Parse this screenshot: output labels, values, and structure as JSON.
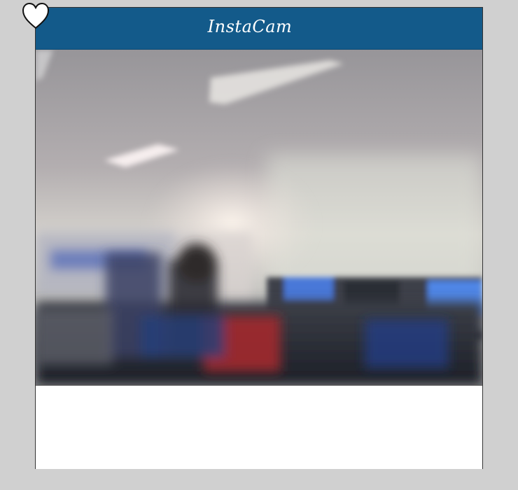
{
  "app": {
    "title": "InstaCam"
  },
  "header": {
    "background_color": "#135a8a",
    "text_color": "#ffffff"
  },
  "like": {
    "icon": "heart-outline-icon"
  },
  "photo": {
    "description_kind": "camera-photo"
  },
  "caption": {
    "text": ""
  }
}
